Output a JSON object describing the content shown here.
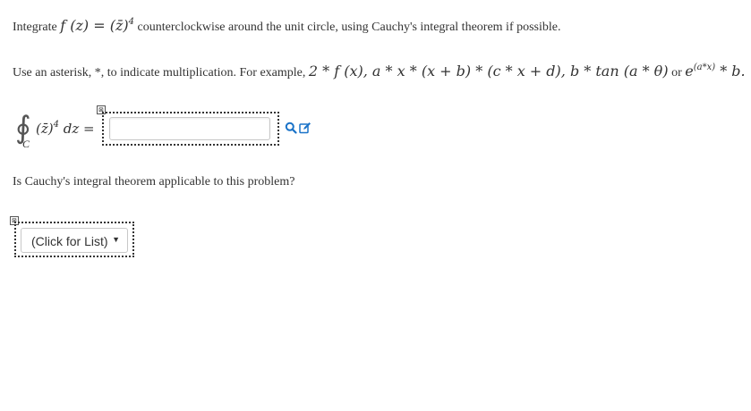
{
  "question1": {
    "prefix": "Integrate",
    "func_lhs": "f (z) = (z̄)",
    "func_exp": "4",
    "suffix": "counterclockwise around the unit circle, using Cauchy's integral theorem if possible."
  },
  "instructions": {
    "text1": "Use an asterisk, *, to indicate multiplication. For example,",
    "ex1": "2 * f (x), a * x * (x + b) * (c * x + d), b * tan (a * θ)",
    "or": "or",
    "ex2_base": "e",
    "ex2_exp": "(a*x)",
    "ex2_tail": "* b."
  },
  "integral": {
    "symbol": "∮",
    "contour": "C",
    "integrand": "(z̄)",
    "exp": "4",
    "dz": "dz ="
  },
  "answer": {
    "value": "",
    "placeholder": ""
  },
  "question2": {
    "text": "Is Cauchy's integral theorem applicable to this problem?"
  },
  "select": {
    "selected": "(Click for List)",
    "arrow": "▼"
  },
  "icons": {
    "close": "⊠",
    "preview": "search-icon",
    "edit": "edit-icon"
  },
  "colors": {
    "accent": "#1a73c8",
    "text": "#333333"
  }
}
